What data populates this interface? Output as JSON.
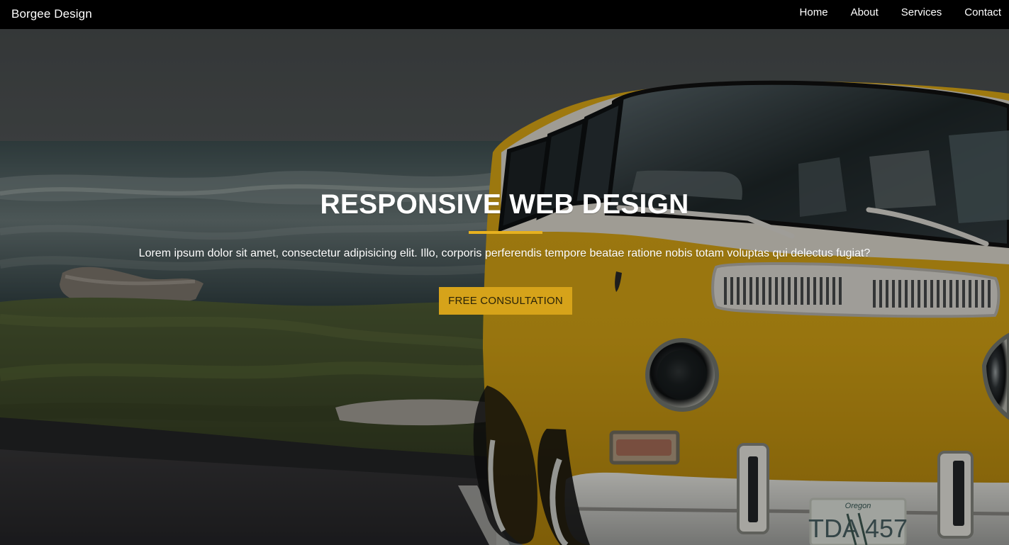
{
  "site": {
    "brand": "Borgee Design"
  },
  "navigation": {
    "items": [
      {
        "label": "Home"
      },
      {
        "label": "About"
      },
      {
        "label": "Services"
      },
      {
        "label": "Contact"
      }
    ]
  },
  "hero": {
    "title": "RESPONSIVE WEB DESIGN",
    "text": "Lorem ipsum dolor sit amet, consectetur adipisicing elit. Illo, corporis perferendis tempore beatae ratione nobis totam voluptas qui delectus fugiat?",
    "button_label": "FREE CONSULTATION",
    "license_plate": "TDA 457",
    "license_state": "Oregon"
  },
  "colors": {
    "nav_background": "#000000",
    "accent": "#d6a31a"
  }
}
